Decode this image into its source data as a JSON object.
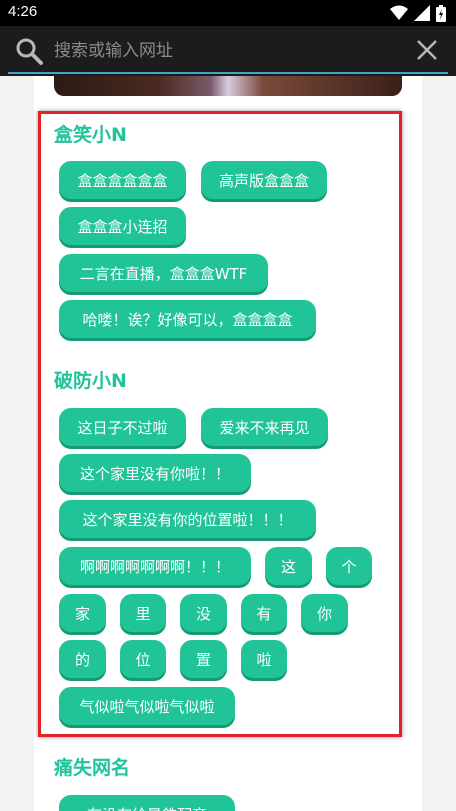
{
  "status_bar": {
    "time": "4:26"
  },
  "search": {
    "placeholder": "搜索或输入网址"
  },
  "sections": [
    {
      "title": "盒笑小N",
      "buttons": [
        "盒盒盒盒盒盒",
        "高声版盒盒盒",
        "盒盒盒小连招",
        "二言在直播，盒盒盒WTF",
        "哈喽！诶？好像可以，盒盒盒盒"
      ]
    },
    {
      "title": "破防小N",
      "buttons": [
        "这日子不过啦",
        "爱来不来再见",
        "这个家里没有你啦！！",
        "这个家里没有你的位置啦！！！",
        "啊啊啊啊啊啊啊！！！",
        "这",
        "个",
        "家",
        "里",
        "没",
        "有",
        "你",
        "的",
        "位",
        "置",
        "啦",
        "气似啦气似啦气似啦"
      ]
    },
    {
      "title": "痛失网名",
      "buttons": [
        "有没有给暑鉄配音"
      ]
    }
  ],
  "colors": {
    "accent": "#21c497",
    "highlight": "#e0232a",
    "search_bg": "#1c1c1c"
  }
}
